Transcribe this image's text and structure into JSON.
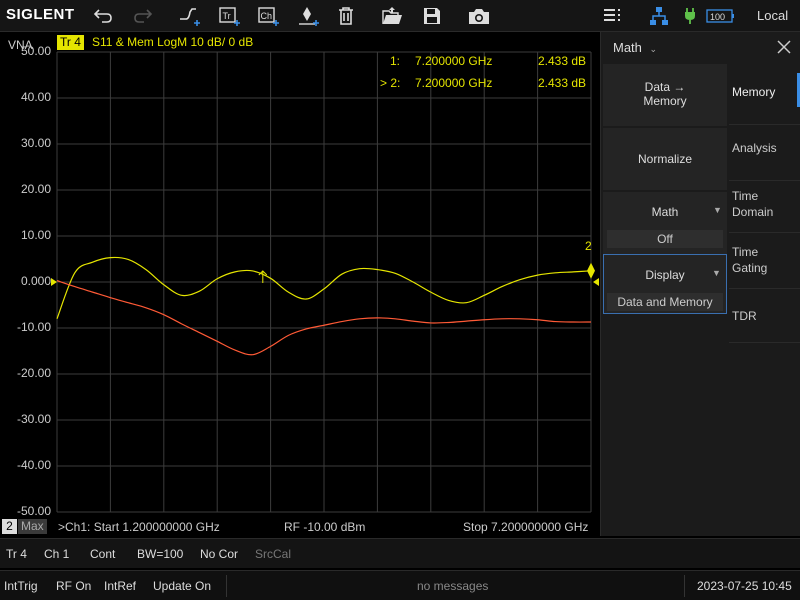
{
  "toolbar": {
    "logo": "SIGLENT",
    "local_label": "Local",
    "battery_level": "100",
    "icons": [
      "undo-icon",
      "redo-icon",
      "trace-add-icon",
      "trace-menu-icon",
      "channel-icon",
      "marker-add-icon",
      "delete-icon",
      "open-icon",
      "save-icon",
      "camera-icon",
      "menu-icon",
      "network-icon",
      "power-icon",
      "battery-icon"
    ]
  },
  "plot": {
    "instrument_label": "VNA",
    "trace_tag": "Tr 4",
    "trace_info": "S11 & Mem  LogM  10 dB/  0 dB",
    "y_ticks": [
      "50.00",
      "40.00",
      "30.00",
      "20.00",
      "10.00",
      "0.000",
      "-10.00",
      "-20.00",
      "-30.00",
      "-40.00",
      "-50.00"
    ],
    "marker_readouts": [
      {
        "id": "1:",
        "freq": "7.200000 GHz",
        "value": "2.433 dB"
      },
      {
        "id": "> 2:",
        "freq": "7.200000 GHz",
        "value": "2.433 dB"
      }
    ],
    "marker_2_label": "2",
    "channel_tab_num": "2",
    "channel_tab_max": "Max",
    "start_text": ">Ch1: Start 1.200000000 GHz",
    "power_text": "RF -10.00 dBm",
    "stop_text": "Stop 7.200000000 GHz",
    "colors": {
      "trace": "#e5e500",
      "memory": "#ff5a36",
      "grid": "#3c3c3c"
    }
  },
  "chart_data": {
    "type": "line",
    "title": "",
    "xlabel": "",
    "ylabel": "",
    "x_range_ghz": [
      1.2,
      7.2
    ],
    "ylim": [
      -50,
      50
    ],
    "y_ticks": [
      50,
      40,
      30,
      20,
      10,
      0,
      -10,
      -20,
      -30,
      -40,
      -50
    ],
    "grid": true,
    "x": [
      1.2,
      1.4,
      1.6,
      1.8,
      2.0,
      2.2,
      2.4,
      2.6,
      2.8,
      3.0,
      3.2,
      3.4,
      3.6,
      3.8,
      4.0,
      4.2,
      4.4,
      4.6,
      4.8,
      5.0,
      5.2,
      5.4,
      5.6,
      5.8,
      6.0,
      6.2,
      6.4,
      6.6,
      6.8,
      7.0,
      7.2
    ],
    "series": [
      {
        "values": [
          -8.0,
          2.0,
          4.3,
          5.3,
          4.9,
          2.7,
          -0.6,
          -2.9,
          -2.0,
          0.7,
          2.2,
          2.4,
          0.8,
          -2.2,
          -3.7,
          -1.5,
          1.7,
          2.9,
          2.7,
          1.9,
          0.0,
          -2.2,
          -4.0,
          -4.5,
          -2.9,
          -1.0,
          0.5,
          1.5,
          2.0,
          2.2,
          2.433
        ]
      },
      {
        "values": [
          0.3,
          -1.0,
          -2.2,
          -3.4,
          -4.5,
          -5.6,
          -7.1,
          -9.1,
          -11.0,
          -12.9,
          -14.8,
          -15.8,
          -14.0,
          -11.6,
          -10.2,
          -9.4,
          -8.6,
          -8.0,
          -7.8,
          -8.0,
          -8.5,
          -8.9,
          -8.8,
          -8.5,
          -8.2,
          -8.0,
          -8.0,
          -8.2,
          -8.6,
          -8.7,
          -8.7
        ]
      }
    ],
    "markers": [
      {
        "id": "1",
        "x": 7.2,
        "y": 2.433
      },
      {
        "id": "2",
        "x": 7.2,
        "y": 2.433
      }
    ]
  },
  "status_bar": {
    "trace": "Tr 4",
    "channel": "Ch 1",
    "sweep": "Cont",
    "bw": "BW=100",
    "correction": "No Cor",
    "srccal": "SrcCal",
    "trigger": "IntTrig",
    "rf": "RF On",
    "ref": "IntRef",
    "update": "Update On",
    "message": "no messages",
    "datetime": "2023-07-25 10:45"
  },
  "panel": {
    "title": "Math",
    "data_memory": "Data →\nMemory",
    "data_memory_l1": "Data →",
    "data_memory_l2": "Memory",
    "normalize": "Normalize",
    "math_label": "Math",
    "math_value": "Off",
    "display_label": "Display",
    "display_value": "Data and Memory",
    "tabs": [
      "Memory",
      "Analysis",
      "Time\nDomain",
      "Time\nGating",
      "TDR"
    ],
    "tab_memory": "Memory",
    "tab_analysis": "Analysis",
    "tab_time_domain_1": "Time",
    "tab_time_domain_2": "Domain",
    "tab_time_gating_1": "Time",
    "tab_time_gating_2": "Gating",
    "tab_tdr": "TDR"
  }
}
